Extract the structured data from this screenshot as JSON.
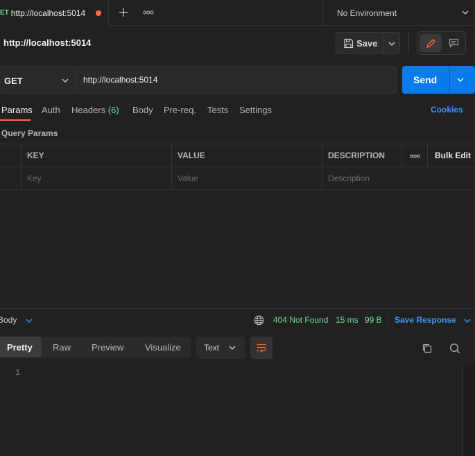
{
  "tab": {
    "method": "ET",
    "title": "http://localhost:5014"
  },
  "environment": {
    "label": "No Environment"
  },
  "request": {
    "title": "http://localhost:5014",
    "save_label": "Save",
    "method": "GET",
    "url": "http://localhost:5014",
    "send_label": "Send"
  },
  "request_tabs": {
    "params": "Params",
    "auth": "Auth",
    "headers": "Headers",
    "headers_count": "(6)",
    "body": "Body",
    "prereq": "Pre-req.",
    "tests": "Tests",
    "settings": "Settings",
    "cookies": "Cookies"
  },
  "query_params": {
    "title": "Query Params",
    "columns": {
      "key": "KEY",
      "value": "VALUE",
      "description": "DESCRIPTION",
      "bulk_edit": "Bulk Edit"
    },
    "placeholders": {
      "key": "Key",
      "value": "Value",
      "description": "Description"
    }
  },
  "response": {
    "section_label": "Body",
    "status": "404 Not Found",
    "time": "15 ms",
    "size": "99 B",
    "save_response": "Save Response",
    "views": [
      "Pretty",
      "Raw",
      "Preview",
      "Visualize"
    ],
    "format": "Text",
    "line_numbers": [
      "1"
    ]
  },
  "colors": {
    "accent": "#ff6c37",
    "send": "#097bed",
    "link": "#3d95f0",
    "success": "#6bdd9a"
  }
}
